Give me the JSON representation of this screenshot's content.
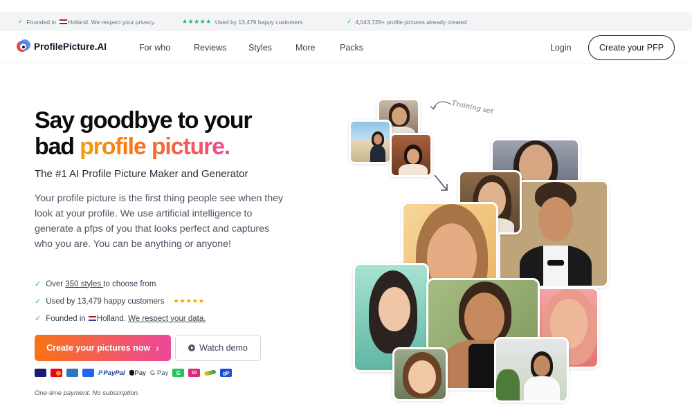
{
  "topbar": {
    "item1": "Founded in",
    "item1_country": "Holland. We respect your privacy.",
    "item2_stars": "★★★★★",
    "item2": "Used by 13,479 happy customers",
    "item3": "4,043,728+ profile pictures already created"
  },
  "header": {
    "logo": "ProfilePicture.AI",
    "nav": [
      "For who",
      "Reviews",
      "Styles",
      "More",
      "Packs"
    ],
    "login": "Login",
    "cta": "Create your PFP"
  },
  "hero": {
    "title_line1": "Say goodbye to your",
    "title_line2_plain": "bad ",
    "title_line2_accent": "profile picture.",
    "subtitle": "The #1 AI Profile Picture Maker and Generator",
    "description": "Your profile picture is the first thing people see when they look at your profile. We use artificial intelligence to generate a pfps of you that looks perfect and captures who you are. You can be anything or anyone!",
    "bullets": {
      "b1_pre": "Over ",
      "b1_link": "350 styles ",
      "b1_post": "to choose from",
      "b2": "Used by 13,479 happy customers",
      "b2_stars": "★★★★★",
      "b3_pre": "Founded in",
      "b3_mid": "Holland. ",
      "b3_link": "We respect your data."
    },
    "primary_button": "Create your pictures now",
    "primary_chevron": "›",
    "secondary_button": "Watch demo",
    "payment_methods": [
      "VISA",
      "Mastercard",
      "Amex",
      "PayPal",
      "Apple Pay",
      "G Pay",
      "G",
      "iD",
      "Klarna",
      "gP"
    ],
    "pay_labels": {
      "paypal": "PayPal",
      "applepay": "Pay",
      "gpay": "G Pay"
    },
    "note": "One-time payment. No subscription."
  },
  "collage": {
    "training_label": "Training set"
  },
  "colors": {
    "accent_orange": "#f97316",
    "accent_pink": "#ec4899",
    "check_green": "#22c55e",
    "text_dark": "#0b0b0f"
  }
}
